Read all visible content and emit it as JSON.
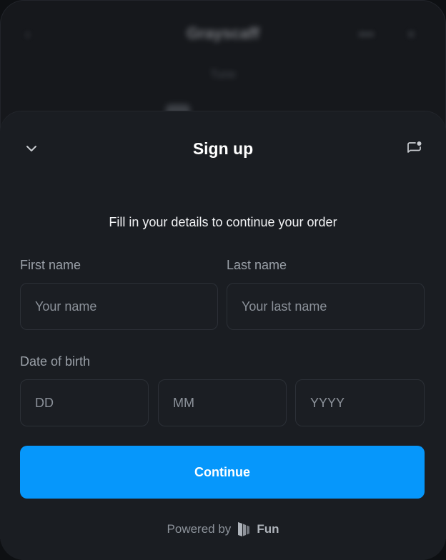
{
  "background": {
    "title": "Grayscaff",
    "subtitle": "Tune",
    "more_label": "•••",
    "back_label": "‹",
    "close_label": "×"
  },
  "sheet": {
    "title": "Sign up",
    "subtitle": "Fill in your details to continue your order",
    "collapse_icon": "chevron-down-icon",
    "feedback_icon": "chat-notification-icon"
  },
  "form": {
    "first_name": {
      "label": "First name",
      "placeholder": "Your name",
      "value": ""
    },
    "last_name": {
      "label": "Last name",
      "placeholder": "Your last name",
      "value": ""
    },
    "dob": {
      "label": "Date of birth",
      "day_placeholder": "DD",
      "month_placeholder": "MM",
      "year_placeholder": "YYYY"
    },
    "continue_label": "Continue"
  },
  "footer": {
    "powered_by": "Powered by",
    "brand": "Fun"
  },
  "colors": {
    "accent": "#0697fb",
    "sheet_bg": "#1a1d22",
    "field_border": "#2c3037"
  }
}
